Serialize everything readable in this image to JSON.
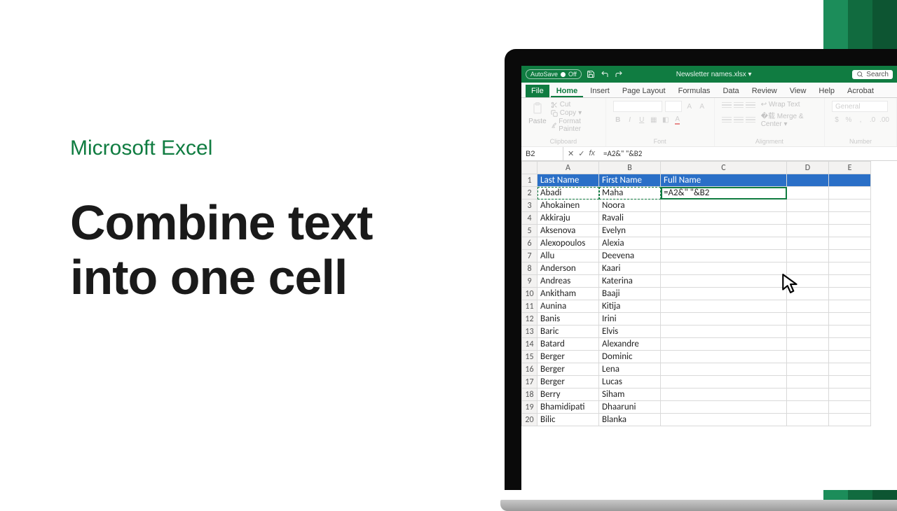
{
  "promo": {
    "app_name": "Microsoft Excel",
    "headline_l1": "Combine text",
    "headline_l2": "into one cell"
  },
  "titlebar": {
    "autosave_label": "AutoSave",
    "autosave_state": "Off",
    "doc_title": "Newsletter names.xlsx",
    "search_placeholder": "Search"
  },
  "tabs": {
    "file": "File",
    "home": "Home",
    "insert": "Insert",
    "page_layout": "Page Layout",
    "formulas": "Formulas",
    "data": "Data",
    "review": "Review",
    "view": "View",
    "help": "Help",
    "acrobat": "Acrobat"
  },
  "ribbon": {
    "paste": "Paste",
    "cut": "Cut",
    "copy": "Copy",
    "format_painter": "Format Painter",
    "clipboard_label": "Clipboard",
    "font_label": "Font",
    "alignment_label": "Alignment",
    "wrap_text": "Wrap Text",
    "merge_center": "Merge & Center",
    "number_label": "Number",
    "number_format": "General"
  },
  "formula_bar": {
    "name_box": "B2",
    "fx": "fx",
    "formula": "=A2&\" \"&B2"
  },
  "columns": [
    "A",
    "B",
    "C",
    "D",
    "E"
  ],
  "headers": {
    "a": "Last Name",
    "b": "First Name",
    "c": "Full Name"
  },
  "active_cell_display": "=A2&\" \"&B2",
  "rows": [
    {
      "n": 2,
      "a": "Abadi",
      "b": "Maha"
    },
    {
      "n": 3,
      "a": "Ahokainen",
      "b": "Noora"
    },
    {
      "n": 4,
      "a": "Akkiraju",
      "b": "Ravali"
    },
    {
      "n": 5,
      "a": "Aksenova",
      "b": "Evelyn"
    },
    {
      "n": 6,
      "a": "Alexopoulos",
      "b": "Alexia"
    },
    {
      "n": 7,
      "a": "Allu",
      "b": "Deevena"
    },
    {
      "n": 8,
      "a": "Anderson",
      "b": "Kaari"
    },
    {
      "n": 9,
      "a": "Andreas",
      "b": "Katerina"
    },
    {
      "n": 10,
      "a": "Ankitham",
      "b": "Baaji"
    },
    {
      "n": 11,
      "a": "Aunina",
      "b": "Kitija"
    },
    {
      "n": 12,
      "a": "Banis",
      "b": "Irini"
    },
    {
      "n": 13,
      "a": "Baric",
      "b": "Elvis"
    },
    {
      "n": 14,
      "a": "Batard",
      "b": "Alexandre"
    },
    {
      "n": 15,
      "a": "Berger",
      "b": "Dominic"
    },
    {
      "n": 16,
      "a": "Berger",
      "b": "Lena"
    },
    {
      "n": 17,
      "a": "Berger",
      "b": "Lucas"
    },
    {
      "n": 18,
      "a": "Berry",
      "b": "Siham"
    },
    {
      "n": 19,
      "a": "Bhamidipati",
      "b": "Dhaaruni"
    },
    {
      "n": 20,
      "a": "Bilic",
      "b": "Blanka"
    }
  ]
}
